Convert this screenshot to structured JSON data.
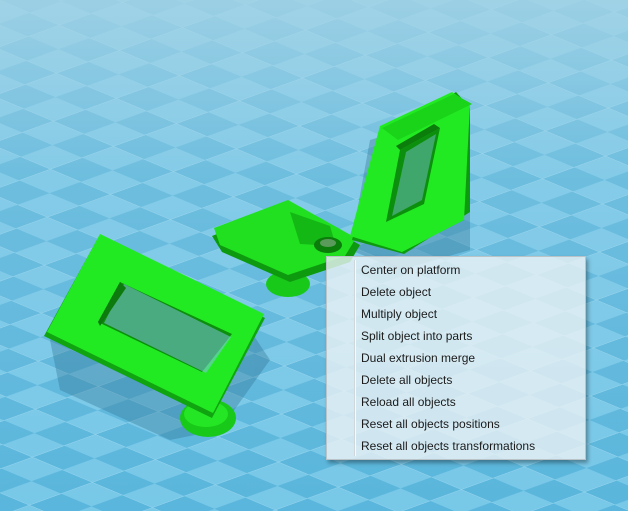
{
  "viewport": {
    "background_color": "#7ec3e2",
    "grid_color_light": "#6cc3e4",
    "grid_color_dark": "#4aa9d2",
    "object_color": "#1ee51e",
    "object_dark_color": "#10a410"
  },
  "context_menu": {
    "items": [
      {
        "label": "Center on platform",
        "highlighted": false
      },
      {
        "label": "Delete object",
        "highlighted": false
      },
      {
        "label": "Multiply object",
        "highlighted": false
      },
      {
        "label": "Split object into parts",
        "highlighted": false
      },
      {
        "label": "Dual extrusion merge",
        "highlighted": true,
        "highlight_color": "#f4f33a"
      },
      {
        "label": "Delete all objects",
        "highlighted": false
      },
      {
        "label": "Reload all objects",
        "highlighted": false
      },
      {
        "label": "Reset all objects positions",
        "highlighted": false
      },
      {
        "label": "Reset all objects transformations",
        "highlighted": false
      }
    ]
  }
}
